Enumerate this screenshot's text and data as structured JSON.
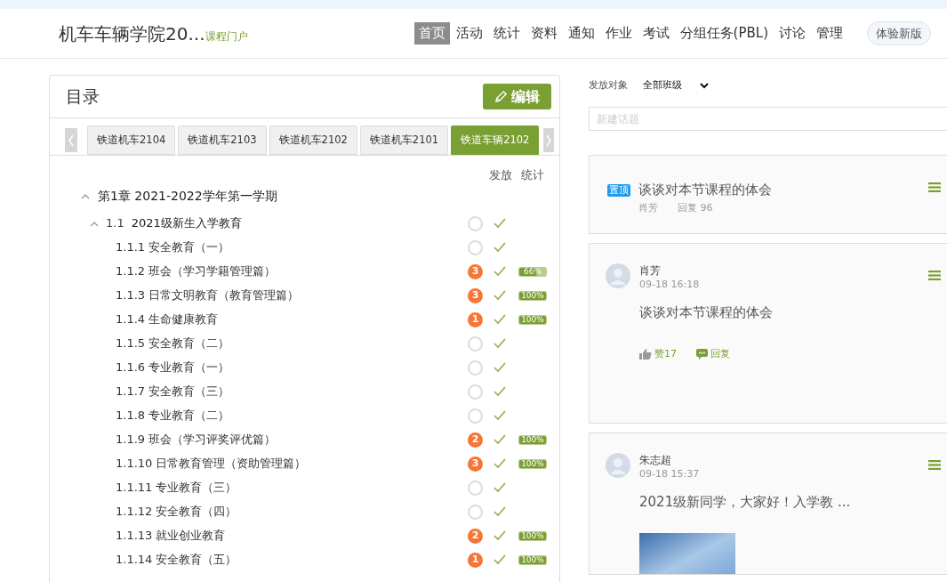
{
  "header": {
    "title": "机车车辆学院20...",
    "subtitle": "课程门户",
    "nav": [
      {
        "label": "首页",
        "selected": true
      },
      {
        "label": "活动",
        "selected": false
      },
      {
        "label": "统计",
        "selected": false
      },
      {
        "label": "资料",
        "selected": false
      },
      {
        "label": "通知",
        "selected": false
      },
      {
        "label": "作业",
        "selected": false
      },
      {
        "label": "考试",
        "selected": false
      },
      {
        "label": "分组任务(PBL)",
        "selected": false
      },
      {
        "label": "讨论",
        "selected": false
      },
      {
        "label": "管理",
        "selected": false
      }
    ],
    "new_version_button": "体验新版"
  },
  "catalog": {
    "title": "目录",
    "edit_button": "编辑",
    "class_tabs": [
      {
        "label": "铁道机车2104",
        "selected": false
      },
      {
        "label": "铁道机车2103",
        "selected": false
      },
      {
        "label": "铁道机车2102",
        "selected": false
      },
      {
        "label": "铁道机车2101",
        "selected": false
      },
      {
        "label": "铁道车辆2102",
        "selected": true
      }
    ],
    "column_headers": [
      "发放",
      "统计"
    ],
    "chapter": {
      "title": "第1章 2021-2022学年第一学期",
      "expanded": true,
      "section": {
        "number": "1.1",
        "title": "2021级新生入学教育",
        "expanded": true,
        "released": true,
        "lessons": [
          {
            "title": "1.1.1 安全教育（一）",
            "released": true
          },
          {
            "title": "1.1.2 班会（学习学籍管理篇）",
            "count": "3",
            "released": true,
            "progress": {
              "level": 0.66,
              "label": "66%"
            }
          },
          {
            "title": "1.1.3 日常文明教育（教育管理篇）",
            "count": "3",
            "released": true,
            "progress": {
              "level": 1,
              "label": "100%"
            }
          },
          {
            "title": "1.1.4 生命健康教育",
            "count": "1",
            "released": true,
            "progress": {
              "level": 1,
              "label": "100%"
            }
          },
          {
            "title": "1.1.5 安全教育（二）",
            "released": true
          },
          {
            "title": "1.1.6 专业教育（一）",
            "released": true
          },
          {
            "title": "1.1.7 安全教育（三）",
            "released": true
          },
          {
            "title": "1.1.8 专业教育（二）",
            "released": true
          },
          {
            "title": "1.1.9 班会（学习评奖评优篇）",
            "count": "2",
            "released": true,
            "progress": {
              "level": 1,
              "label": "100%"
            }
          },
          {
            "title": "1.1.10 日常教育管理（资助管理篇）",
            "count": "3",
            "released": true,
            "progress": {
              "level": 1,
              "label": "100%"
            }
          },
          {
            "title": "1.1.11 专业教育（三）",
            "released": true
          },
          {
            "title": "1.1.12 安全教育（四）",
            "released": true
          },
          {
            "title": "1.1.13 就业创业教育",
            "count": "2",
            "released": true,
            "progress": {
              "level": 1,
              "label": "100%"
            }
          },
          {
            "title": "1.1.14 安全教育（五）",
            "count": "1",
            "released": true,
            "progress": {
              "level": 1,
              "label": "100%"
            }
          }
        ]
      }
    }
  },
  "discussion": {
    "audience_label": "发放对象",
    "audience_value": "全部班级",
    "new_topic": {
      "placeholder": "新建话题"
    },
    "posts": [
      {
        "kind": "pinned",
        "badge": "置顶",
        "title": "谈谈对本节课程的体会",
        "author": "肖芳",
        "replies": "回复 96"
      },
      {
        "kind": "post",
        "author": "肖芳",
        "time": "09-18 16:18",
        "text": "谈谈对本节课程的体会",
        "like": "赞17",
        "reply": "回复"
      },
      {
        "kind": "post",
        "author": "朱志超",
        "time": "09-18 15:37",
        "text": "2021级新同学，大家好！入学教 ...",
        "photo": true
      }
    ]
  }
}
